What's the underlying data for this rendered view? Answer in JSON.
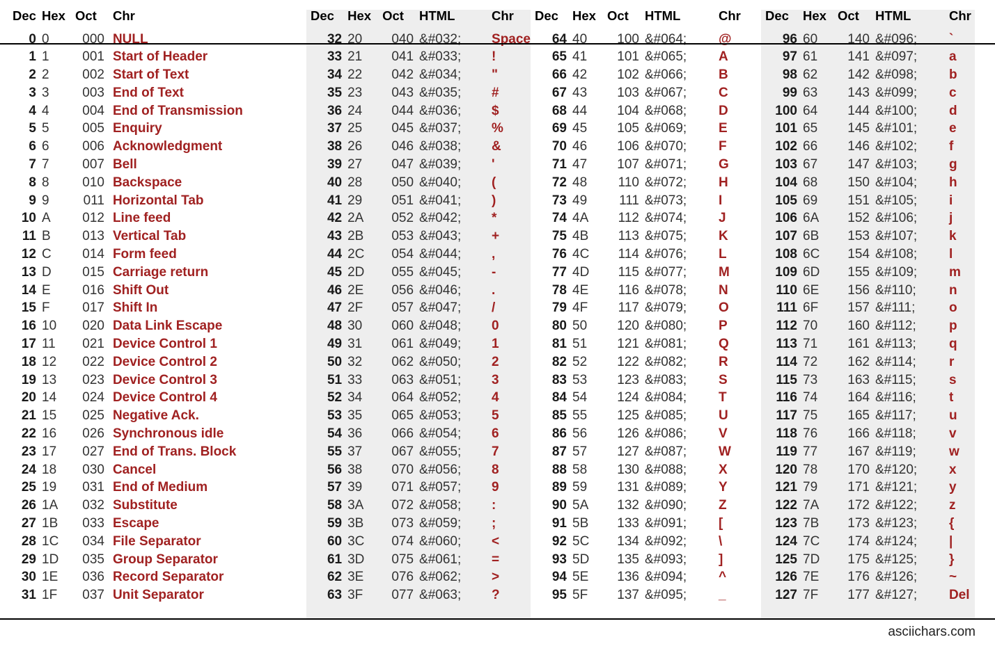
{
  "meta": {
    "footer": "asciichars.com",
    "accent_red": "#a02121",
    "band_bg": "#eeeeee",
    "page_bg": "#ffffff"
  },
  "headers": {
    "dec": "Dec",
    "hex": "Hex",
    "oct": "Oct",
    "chr": "Chr",
    "html": "HTML"
  },
  "blocks": [
    {
      "id": "control-characters",
      "columns": [
        "Dec",
        "Hex",
        "Oct",
        "Chr"
      ],
      "shaded": false,
      "rows": [
        [
          "0",
          "0",
          "000",
          "NULL"
        ],
        [
          "1",
          "1",
          "001",
          "Start of Header"
        ],
        [
          "2",
          "2",
          "002",
          "Start of Text"
        ],
        [
          "3",
          "3",
          "003",
          "End of Text"
        ],
        [
          "4",
          "4",
          "004",
          "End of Transmission"
        ],
        [
          "5",
          "5",
          "005",
          "Enquiry"
        ],
        [
          "6",
          "6",
          "006",
          "Acknowledgment"
        ],
        [
          "7",
          "7",
          "007",
          "Bell"
        ],
        [
          "8",
          "8",
          "010",
          "Backspace"
        ],
        [
          "9",
          "9",
          "011",
          "Horizontal Tab"
        ],
        [
          "10",
          "A",
          "012",
          "Line feed"
        ],
        [
          "11",
          "B",
          "013",
          "Vertical Tab"
        ],
        [
          "12",
          "C",
          "014",
          "Form feed"
        ],
        [
          "13",
          "D",
          "015",
          "Carriage return"
        ],
        [
          "14",
          "E",
          "016",
          "Shift Out"
        ],
        [
          "15",
          "F",
          "017",
          "Shift In"
        ],
        [
          "16",
          "10",
          "020",
          "Data Link Escape"
        ],
        [
          "17",
          "11",
          "021",
          "Device Control 1"
        ],
        [
          "18",
          "12",
          "022",
          "Device Control 2"
        ],
        [
          "19",
          "13",
          "023",
          "Device Control 3"
        ],
        [
          "20",
          "14",
          "024",
          "Device Control 4"
        ],
        [
          "21",
          "15",
          "025",
          "Negative Ack."
        ],
        [
          "22",
          "16",
          "026",
          "Synchronous idle"
        ],
        [
          "23",
          "17",
          "027",
          "End of Trans. Block"
        ],
        [
          "24",
          "18",
          "030",
          "Cancel"
        ],
        [
          "25",
          "19",
          "031",
          "End of Medium"
        ],
        [
          "26",
          "1A",
          "032",
          "Substitute"
        ],
        [
          "27",
          "1B",
          "033",
          "Escape"
        ],
        [
          "28",
          "1C",
          "034",
          "File Separator"
        ],
        [
          "29",
          "1D",
          "035",
          "Group Separator"
        ],
        [
          "30",
          "1E",
          "036",
          "Record Separator"
        ],
        [
          "31",
          "1F",
          "037",
          "Unit Separator"
        ]
      ]
    },
    {
      "id": "printable-32-63",
      "columns": [
        "Dec",
        "Hex",
        "Oct",
        "HTML",
        "Chr"
      ],
      "shaded": true,
      "rows": [
        [
          "32",
          "20",
          "040",
          "&#032;",
          "Space"
        ],
        [
          "33",
          "21",
          "041",
          "&#033;",
          "!"
        ],
        [
          "34",
          "22",
          "042",
          "&#034;",
          "\""
        ],
        [
          "35",
          "23",
          "043",
          "&#035;",
          "#"
        ],
        [
          "36",
          "24",
          "044",
          "&#036;",
          "$"
        ],
        [
          "37",
          "25",
          "045",
          "&#037;",
          "%"
        ],
        [
          "38",
          "26",
          "046",
          "&#038;",
          "&"
        ],
        [
          "39",
          "27",
          "047",
          "&#039;",
          "'"
        ],
        [
          "40",
          "28",
          "050",
          "&#040;",
          "("
        ],
        [
          "41",
          "29",
          "051",
          "&#041;",
          ")"
        ],
        [
          "42",
          "2A",
          "052",
          "&#042;",
          "*"
        ],
        [
          "43",
          "2B",
          "053",
          "&#043;",
          "+"
        ],
        [
          "44",
          "2C",
          "054",
          "&#044;",
          ","
        ],
        [
          "45",
          "2D",
          "055",
          "&#045;",
          "-"
        ],
        [
          "46",
          "2E",
          "056",
          "&#046;",
          "."
        ],
        [
          "47",
          "2F",
          "057",
          "&#047;",
          "/"
        ],
        [
          "48",
          "30",
          "060",
          "&#048;",
          "0"
        ],
        [
          "49",
          "31",
          "061",
          "&#049;",
          "1"
        ],
        [
          "50",
          "32",
          "062",
          "&#050;",
          "2"
        ],
        [
          "51",
          "33",
          "063",
          "&#051;",
          "3"
        ],
        [
          "52",
          "34",
          "064",
          "&#052;",
          "4"
        ],
        [
          "53",
          "35",
          "065",
          "&#053;",
          "5"
        ],
        [
          "54",
          "36",
          "066",
          "&#054;",
          "6"
        ],
        [
          "55",
          "37",
          "067",
          "&#055;",
          "7"
        ],
        [
          "56",
          "38",
          "070",
          "&#056;",
          "8"
        ],
        [
          "57",
          "39",
          "071",
          "&#057;",
          "9"
        ],
        [
          "58",
          "3A",
          "072",
          "&#058;",
          ":"
        ],
        [
          "59",
          "3B",
          "073",
          "&#059;",
          ";"
        ],
        [
          "60",
          "3C",
          "074",
          "&#060;",
          "<"
        ],
        [
          "61",
          "3D",
          "075",
          "&#061;",
          "="
        ],
        [
          "62",
          "3E",
          "076",
          "&#062;",
          ">"
        ],
        [
          "63",
          "3F",
          "077",
          "&#063;",
          "?"
        ]
      ]
    },
    {
      "id": "printable-64-95",
      "columns": [
        "Dec",
        "Hex",
        "Oct",
        "HTML",
        "Chr"
      ],
      "shaded": false,
      "rows": [
        [
          "64",
          "40",
          "100",
          "&#064;",
          "@"
        ],
        [
          "65",
          "41",
          "101",
          "&#065;",
          "A"
        ],
        [
          "66",
          "42",
          "102",
          "&#066;",
          "B"
        ],
        [
          "67",
          "43",
          "103",
          "&#067;",
          "C"
        ],
        [
          "68",
          "44",
          "104",
          "&#068;",
          "D"
        ],
        [
          "69",
          "45",
          "105",
          "&#069;",
          "E"
        ],
        [
          "70",
          "46",
          "106",
          "&#070;",
          "F"
        ],
        [
          "71",
          "47",
          "107",
          "&#071;",
          "G"
        ],
        [
          "72",
          "48",
          "110",
          "&#072;",
          "H"
        ],
        [
          "73",
          "49",
          "111",
          "&#073;",
          "I"
        ],
        [
          "74",
          "4A",
          "112",
          "&#074;",
          "J"
        ],
        [
          "75",
          "4B",
          "113",
          "&#075;",
          "K"
        ],
        [
          "76",
          "4C",
          "114",
          "&#076;",
          "L"
        ],
        [
          "77",
          "4D",
          "115",
          "&#077;",
          "M"
        ],
        [
          "78",
          "4E",
          "116",
          "&#078;",
          "N"
        ],
        [
          "79",
          "4F",
          "117",
          "&#079;",
          "O"
        ],
        [
          "80",
          "50",
          "120",
          "&#080;",
          "P"
        ],
        [
          "81",
          "51",
          "121",
          "&#081;",
          "Q"
        ],
        [
          "82",
          "52",
          "122",
          "&#082;",
          "R"
        ],
        [
          "83",
          "53",
          "123",
          "&#083;",
          "S"
        ],
        [
          "84",
          "54",
          "124",
          "&#084;",
          "T"
        ],
        [
          "85",
          "55",
          "125",
          "&#085;",
          "U"
        ],
        [
          "86",
          "56",
          "126",
          "&#086;",
          "V"
        ],
        [
          "87",
          "57",
          "127",
          "&#087;",
          "W"
        ],
        [
          "88",
          "58",
          "130",
          "&#088;",
          "X"
        ],
        [
          "89",
          "59",
          "131",
          "&#089;",
          "Y"
        ],
        [
          "90",
          "5A",
          "132",
          "&#090;",
          "Z"
        ],
        [
          "91",
          "5B",
          "133",
          "&#091;",
          "["
        ],
        [
          "92",
          "5C",
          "134",
          "&#092;",
          "\\"
        ],
        [
          "93",
          "5D",
          "135",
          "&#093;",
          "]"
        ],
        [
          "94",
          "5E",
          "136",
          "&#094;",
          "^"
        ],
        [
          "95",
          "5F",
          "137",
          "&#095;",
          "_"
        ]
      ]
    },
    {
      "id": "printable-96-127",
      "columns": [
        "Dec",
        "Hex",
        "Oct",
        "HTML",
        "Chr"
      ],
      "shaded": true,
      "rows": [
        [
          "96",
          "60",
          "140",
          "&#096;",
          "`"
        ],
        [
          "97",
          "61",
          "141",
          "&#097;",
          "a"
        ],
        [
          "98",
          "62",
          "142",
          "&#098;",
          "b"
        ],
        [
          "99",
          "63",
          "143",
          "&#099;",
          "c"
        ],
        [
          "100",
          "64",
          "144",
          "&#100;",
          "d"
        ],
        [
          "101",
          "65",
          "145",
          "&#101;",
          "e"
        ],
        [
          "102",
          "66",
          "146",
          "&#102;",
          "f"
        ],
        [
          "103",
          "67",
          "147",
          "&#103;",
          "g"
        ],
        [
          "104",
          "68",
          "150",
          "&#104;",
          "h"
        ],
        [
          "105",
          "69",
          "151",
          "&#105;",
          "i"
        ],
        [
          "106",
          "6A",
          "152",
          "&#106;",
          "j"
        ],
        [
          "107",
          "6B",
          "153",
          "&#107;",
          "k"
        ],
        [
          "108",
          "6C",
          "154",
          "&#108;",
          "l"
        ],
        [
          "109",
          "6D",
          "155",
          "&#109;",
          "m"
        ],
        [
          "110",
          "6E",
          "156",
          "&#110;",
          "n"
        ],
        [
          "111",
          "6F",
          "157",
          "&#111;",
          "o"
        ],
        [
          "112",
          "70",
          "160",
          "&#112;",
          "p"
        ],
        [
          "113",
          "71",
          "161",
          "&#113;",
          "q"
        ],
        [
          "114",
          "72",
          "162",
          "&#114;",
          "r"
        ],
        [
          "115",
          "73",
          "163",
          "&#115;",
          "s"
        ],
        [
          "116",
          "74",
          "164",
          "&#116;",
          "t"
        ],
        [
          "117",
          "75",
          "165",
          "&#117;",
          "u"
        ],
        [
          "118",
          "76",
          "166",
          "&#118;",
          "v"
        ],
        [
          "119",
          "77",
          "167",
          "&#119;",
          "w"
        ],
        [
          "120",
          "78",
          "170",
          "&#120;",
          "x"
        ],
        [
          "121",
          "79",
          "171",
          "&#121;",
          "y"
        ],
        [
          "122",
          "7A",
          "172",
          "&#122;",
          "z"
        ],
        [
          "123",
          "7B",
          "173",
          "&#123;",
          "{"
        ],
        [
          "124",
          "7C",
          "174",
          "&#124;",
          "|"
        ],
        [
          "125",
          "7D",
          "175",
          "&#125;",
          "}"
        ],
        [
          "126",
          "7E",
          "176",
          "&#126;",
          "~"
        ],
        [
          "127",
          "7F",
          "177",
          "&#127;",
          "Del"
        ]
      ]
    }
  ]
}
